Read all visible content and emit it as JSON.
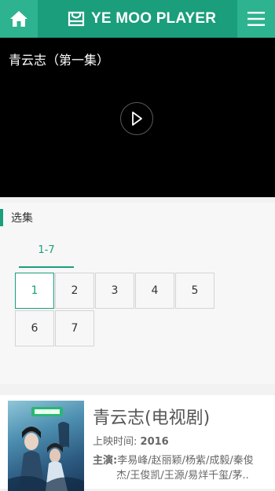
{
  "header": {
    "title": "YE MOO PLAYER",
    "home_icon": "home-icon",
    "menu_icon": "hamburger-menu-icon",
    "logo_icon": "bag-logo-icon",
    "brand_color": "#1a9e7c"
  },
  "player": {
    "video_title": "青云志（第一集）",
    "play_icon": "play-icon"
  },
  "episodes": {
    "section_title": "选集",
    "range_tab": "1-7",
    "items": [
      "1",
      "2",
      "3",
      "4",
      "5",
      "6",
      "7"
    ],
    "active": "1"
  },
  "show": {
    "title": "青云志(电视剧)",
    "release_label": "上映时间:",
    "release_year": "2016",
    "cast_label": "主演:",
    "cast_line1": "李易峰/赵丽颖/杨紫/成毅/秦俊",
    "cast_line2": "杰/王俊凯/王源/易烊千玺/茅.."
  }
}
